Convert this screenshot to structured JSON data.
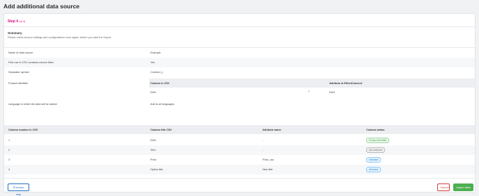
{
  "page": {
    "title": "Add additional data source"
  },
  "step": {
    "label": "Step 4",
    "of": "(of 4)"
  },
  "summary": {
    "title": "Summary",
    "description": "Please check all your settings and configurations once again, before you start the import."
  },
  "settings": [
    {
      "key": "Name of data source",
      "value": "Example"
    },
    {
      "key": "First row in CSV contains column titles",
      "value": "Yes"
    },
    {
      "key": "Separator symbol",
      "value": "Comma (,)"
    },
    {
      "key": "Product identifier",
      "value": ""
    },
    {
      "key": "Language in which the data will be added",
      "value": "Add to all languages"
    }
  ],
  "identifier_table": {
    "headers": [
      "Column in CSV",
      "Attribute in EffectConnect"
    ],
    "row": {
      "csv": "EAN",
      "arrow": "›",
      "attribute": "EAN"
    }
  },
  "columns_table": {
    "headers": [
      "Column number in CSV",
      "Column title CSV",
      "Attribute name",
      "Column status"
    ],
    "rows": [
      {
        "num": "1",
        "title": "EAN",
        "attr": "-",
        "status": "Product identifier",
        "status_color": "#4caf50"
      },
      {
        "num": "2",
        "title": "SKU",
        "attr": "-",
        "status": "Not selected",
        "status_color": "#888888"
      },
      {
        "num": "3",
        "title": "Price",
        "attr": "Price_csv",
        "status": "Selected",
        "status_color": "#1e88e5"
      },
      {
        "num": "4",
        "title": "Option title",
        "attr": "New title",
        "status": "Selected",
        "status_color": "#1e88e5"
      }
    ]
  },
  "buttons": {
    "previous": "Previous step",
    "cancel": "Cancel",
    "import": "Import data"
  },
  "colors": {
    "accent": "#e6007e",
    "primary": "#1b6fc4",
    "danger": "#d23c3c",
    "success": "#4caf50"
  }
}
